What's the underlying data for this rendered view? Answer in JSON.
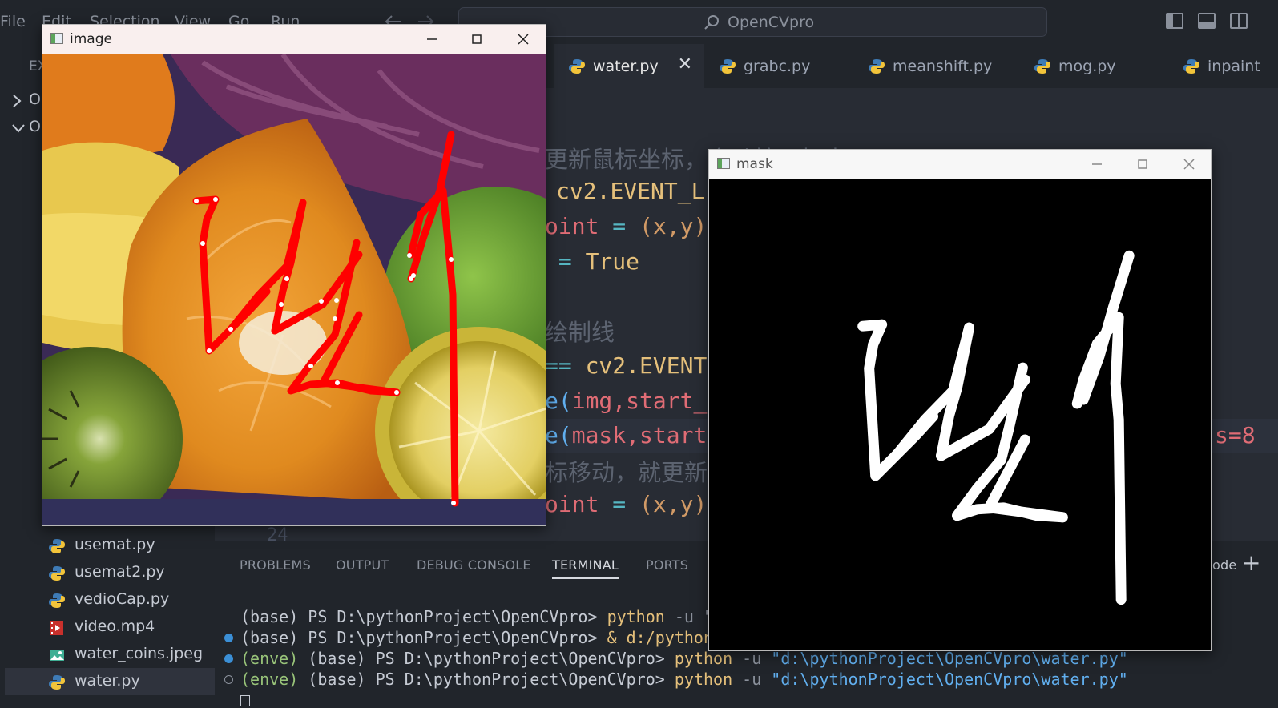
{
  "titlebar": {
    "menu": [
      "File",
      "Edit",
      "Selection",
      "View",
      "Go",
      "Run",
      "..."
    ],
    "search_text": "OpenCVpro"
  },
  "sidebar": {
    "header": "EX",
    "folders": [
      "O",
      "O"
    ],
    "files": [
      {
        "name": "usemat.py",
        "icon": "python-icon"
      },
      {
        "name": "usemat2.py",
        "icon": "python-icon"
      },
      {
        "name": "vedioCap.py",
        "icon": "python-icon"
      },
      {
        "name": "video.mp4",
        "icon": "video-file-icon"
      },
      {
        "name": "water_coins.jpeg",
        "icon": "image-file-icon"
      },
      {
        "name": "water.py",
        "icon": "python-icon",
        "active": true
      }
    ]
  },
  "tabs": [
    {
      "label": "water.py",
      "active": true
    },
    {
      "label": "grabc.py"
    },
    {
      "label": "meanshift.py"
    },
    {
      "label": "mog.py"
    },
    {
      "label": "inpaint"
    }
  ],
  "code": {
    "line1": "更新鼠标坐标，启动按下标志",
    "line2_a": "cv2.",
    "line2_b": "EVENT_L",
    "line3_a": "oint",
    "line3_b": " = ",
    "line3_c": "(x,y)",
    "line4_a": " = ",
    "line4_b": "True",
    "line5": "绘制线",
    "line6_a": "== ",
    "line6_b": "cv2.",
    "line6_c": "EVENT",
    "line7_a": "e(",
    "line7_b": "img",
    "line7_c": ",start_",
    "line8_a": "e(",
    "line8_b": "mask",
    "line8_c": ",start",
    "line8_d": "s=8",
    "line9": "标移动，就更新",
    "line10_a": "oint",
    "line10_b": " = ",
    "line10_c": "(x,y)",
    "line_number": "24"
  },
  "panel": {
    "tabs": [
      "PROBLEMS",
      "OUTPUT",
      "DEBUG CONSOLE",
      "TERMINAL",
      "PORTS"
    ],
    "active_tab": "TERMINAL",
    "right_label": "ode",
    "terminal": [
      {
        "prompt": "(base) PS D:\\pythonProject\\OpenCVpro> ",
        "cmd": "python",
        "rest": " -u \"c",
        "env": ""
      },
      {
        "prompt": "(base) PS D:\\pythonProject\\OpenCVpro> ",
        "cmd": "& d:/pythonP",
        "rest": "",
        "env": ""
      },
      {
        "env": "(enve) ",
        "prompt": "(base) PS D:\\pythonProject\\OpenCVpro> ",
        "cmd": "python",
        "rest": " -u ",
        "str": "\"d:\\pythonProject\\OpenCVpro\\water.py\""
      },
      {
        "env": "(enve) ",
        "prompt": "(base) PS D:\\pythonProject\\OpenCVpro> ",
        "cmd": "python",
        "rest": " -u ",
        "str": "\"d:\\pythonProject\\OpenCVpro\\water.py\""
      }
    ]
  },
  "windows": {
    "image": {
      "title": "image"
    },
    "mask": {
      "title": "mask"
    }
  },
  "colors": {
    "editor_bg": "#282c34",
    "keyword": "#e5c07b",
    "red_token": "#e06c75",
    "stroke_red": "#ff0000"
  }
}
